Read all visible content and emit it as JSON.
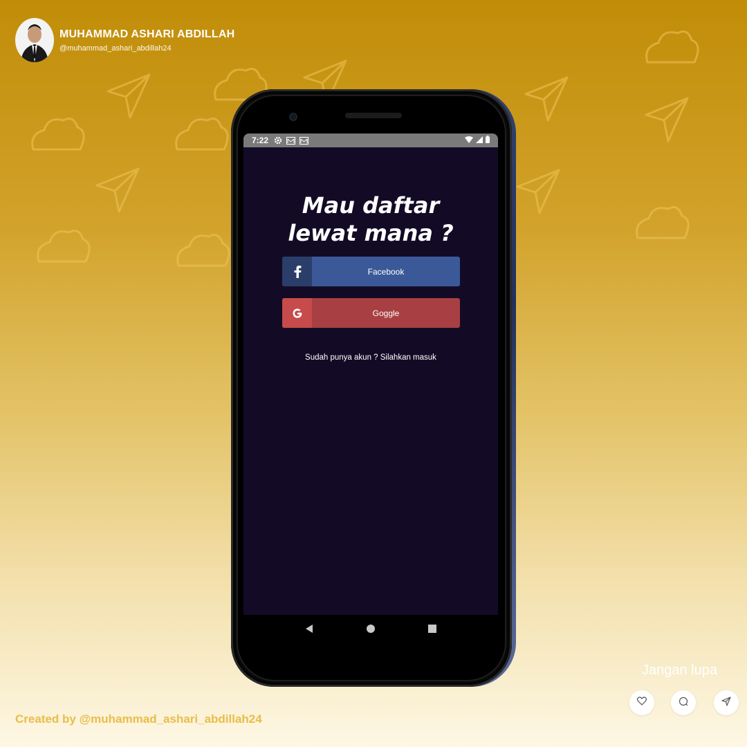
{
  "author": {
    "name": "MUHAMMAD ASHARI ABDILLAH",
    "handle": "@muhammad_ashari_abdillah24"
  },
  "phone": {
    "status_bar": {
      "time": "7:22",
      "icons": [
        "settings-icon",
        "mail-icon",
        "mail-icon",
        "wifi-icon",
        "signal-icon",
        "battery-icon"
      ]
    },
    "screen": {
      "title": "Mau daftar lewat mana ?",
      "facebook_label": "Facebook",
      "google_label": "Goggle",
      "login_link": "Sudah punya akun ? Silahkan masuk"
    },
    "nav": [
      "back-icon",
      "home-icon",
      "recents-icon"
    ]
  },
  "footer": {
    "credit": "Created by @muhammad_ashari_abdillah24",
    "reminder": "Jangan lupa",
    "actions": [
      "heart-icon",
      "comment-icon",
      "send-icon"
    ]
  },
  "colors": {
    "background_top": "#c18d08",
    "background_bottom": "#fdf7e4",
    "screen": "#130b26",
    "facebook": "#3b5998",
    "google": "#a83f42",
    "credit": "#e9bf4a"
  }
}
